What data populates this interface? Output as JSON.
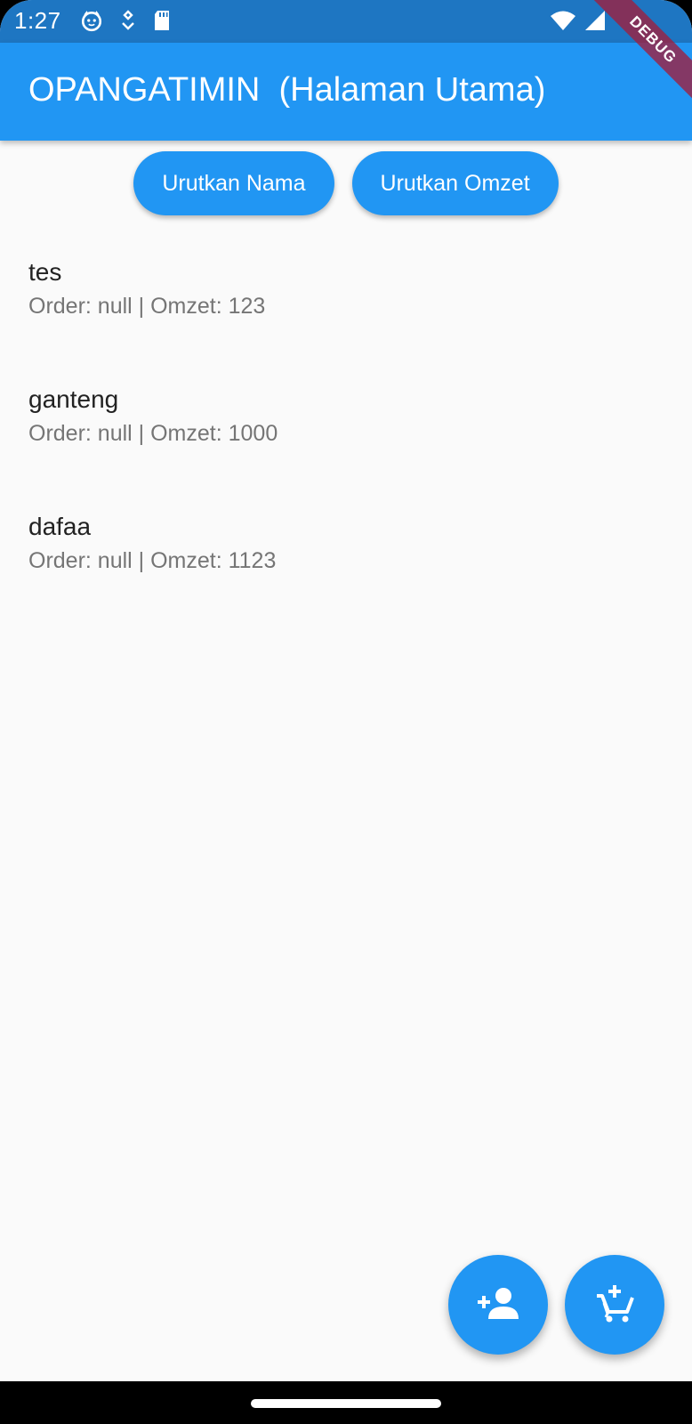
{
  "status_bar": {
    "time": "1:27",
    "icons_left": [
      "cat-notification-icon",
      "location-pin-icon",
      "sd-card-icon"
    ],
    "icons_right": [
      "wifi-icon",
      "signal-icon"
    ]
  },
  "debug_banner": "DEBUG",
  "app_bar": {
    "title": "OPANGATIMIN  (Halaman Utama)"
  },
  "sort_buttons": {
    "by_name": "Urutkan Nama",
    "by_omzet": "Urutkan Omzet"
  },
  "items": [
    {
      "name": "tes",
      "detail": "Order: null | Omzet: 123"
    },
    {
      "name": "ganteng",
      "detail": "Order: null | Omzet: 1000"
    },
    {
      "name": "dafaa",
      "detail": "Order: null | Omzet: 1123"
    }
  ],
  "fabs": {
    "add_person_icon": "person-add-icon",
    "add_cart_icon": "add-shopping-cart-icon"
  },
  "colors": {
    "primary": "#2196f3",
    "status_bar": "#1e76c2",
    "background": "#fafafa"
  }
}
